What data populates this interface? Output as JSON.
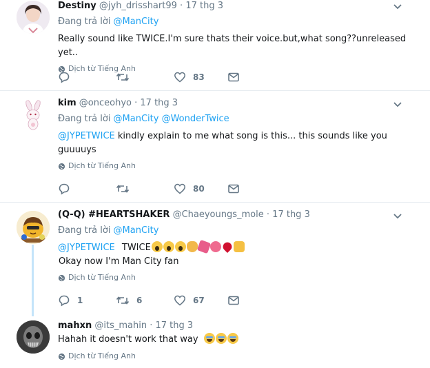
{
  "common": {
    "reply_prefix": "Đang trả lời",
    "translate_label": "Dịch từ Tiếng Anh",
    "dot": "·"
  },
  "tweets": [
    {
      "name": "Destiny",
      "handle": "@jyh_drisshart99",
      "time": "17 thg 3",
      "reply_to": [
        "@ManCity"
      ],
      "text": "Really sound like TWICE.I'm sure thats their voice.but,what song??unreleased yet..",
      "replies": "",
      "retweets": "",
      "likes": "83"
    },
    {
      "name": "kim",
      "handle": "@onceohyo",
      "time": "17 thg 3",
      "reply_to": [
        "@ManCity",
        "@WonderTwice"
      ],
      "text_mention": "@JYPETWICE",
      "text": "kindly explain to me what song is this... this sounds like you guuuuys",
      "replies": "",
      "retweets": "",
      "likes": "80"
    },
    {
      "name": "(Q-Q) #HEARTSHAKER",
      "handle": "@Chaeyoungs_mole",
      "time": "17 thg 3",
      "reply_to": [
        "@ManCity"
      ],
      "text_mention": "@JYPETWICE",
      "text_line1": "TWICE",
      "text_line2": "Okay now I'm Man City fan",
      "replies": "1",
      "retweets": "6",
      "likes": "67"
    },
    {
      "name": "mahxn",
      "handle": "@its_mahin",
      "time": "17 thg 3",
      "text": "Hahah it doesn't work that way"
    }
  ],
  "colors": {
    "link": "#1da1f2",
    "muted": "#657786",
    "thread": "#c4e4fa"
  }
}
